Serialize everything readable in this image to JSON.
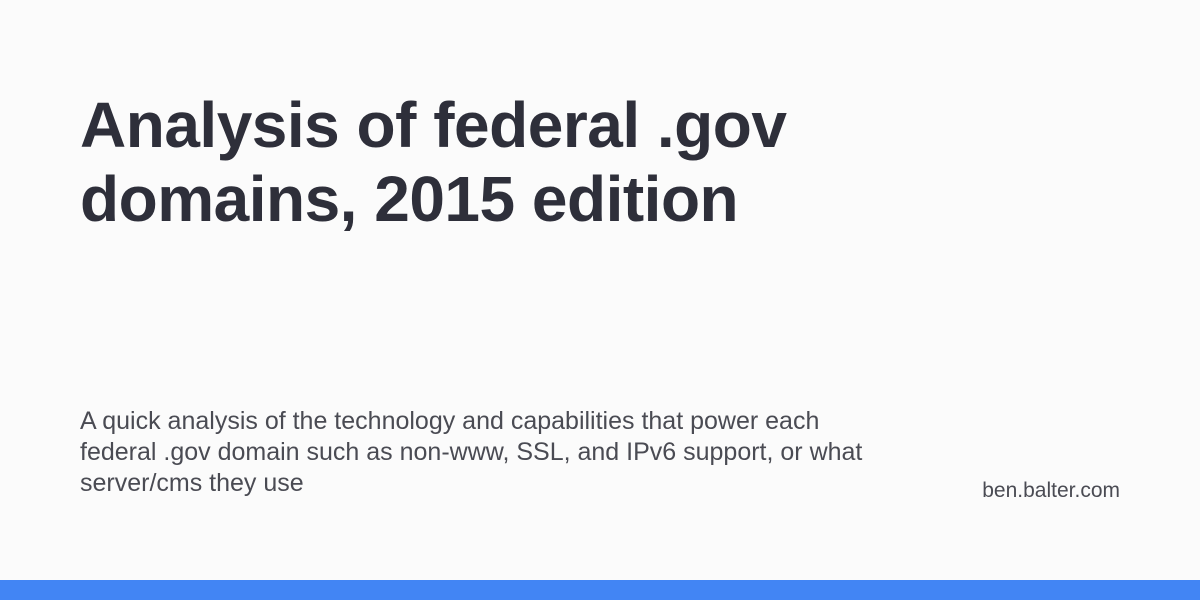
{
  "card": {
    "title": "Analysis of federal .gov domains, 2015 edition",
    "description": "A quick analysis of the technology and capabilities that power each federal .gov domain such as non-www, SSL, and IPv6 support, or what server/cms they use",
    "site": "ben.balter.com"
  },
  "colors": {
    "title": "#2e2f3a",
    "body_text": "#4a4b53",
    "accent_bar": "#4285f4",
    "background": "#fbfbfb"
  }
}
